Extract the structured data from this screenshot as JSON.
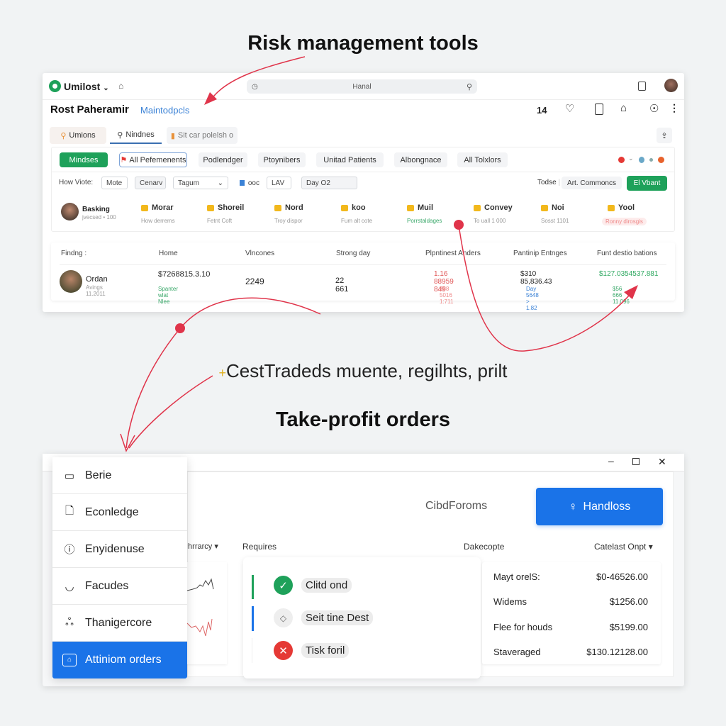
{
  "headings": {
    "top": "Risk management tools",
    "middle": "CestTradeds muente, regilhts, prilt",
    "bottom": "Take-profit orders"
  },
  "top_window": {
    "app_name": "Umilost",
    "search_placeholder": "Hanal",
    "page_title": "Rost Paheramir",
    "page_link": "Maintodpcls",
    "count": "14",
    "tabs": [
      "Umions",
      "Nindnes",
      "Sit car polelsh o"
    ],
    "filters": [
      "Mindses",
      "All Pefemenents",
      "Podlendger",
      "Ptoynibers",
      "Unitad Patients",
      "Albongnace",
      "All Tolxlors"
    ],
    "controls": {
      "label": "How Viote:",
      "mote": "Mote",
      "cenarv": "Cenarv",
      "select": "Tagum",
      "check_label": "ooc",
      "lav": "LAV",
      "day": "Day O2",
      "right_label": "Todse",
      "right_value": "Art. Commoncs",
      "action": "El Vbant"
    },
    "profile": {
      "name": "Basking",
      "sub": "jvecsed • 100"
    },
    "cards": [
      {
        "title": "Morar",
        "sub": "How derrems"
      },
      {
        "title": "Shoreil",
        "sub": "Fetnt Coft"
      },
      {
        "title": "Nord",
        "sub": "Troy dispor"
      },
      {
        "title": "koo",
        "sub": "Fum alt cote"
      },
      {
        "title": "Muil",
        "sub": "Porrstaldages"
      },
      {
        "title": "Convey",
        "sub": "To uall 1 000"
      },
      {
        "title": "Noi",
        "sub": "Sosst 1101"
      },
      {
        "title": "Yool",
        "sub": "Ronny dirosgis"
      }
    ],
    "table": {
      "headers": [
        "Findng :",
        "Home",
        "Vlncones",
        "Strong day",
        "Plpntinest Anders",
        "Pantinip Entnges",
        "Funt destio bations"
      ],
      "row": {
        "name": "Ordan",
        "sub": "Avings 11.2011",
        "home": "$7268815.3.10",
        "home_sub": "Spanter wlat Nlee",
        "vincones": "2249",
        "strong": "22 661",
        "plp": "1.16 88959 849",
        "plp_sub": "$88 5016 1:711",
        "pant": "$310 85,836.43",
        "pant_sub": "Day 5648 > 1.82",
        "funt": "$127.0354537.881",
        "funt_sub": "$56 666 11.096"
      }
    }
  },
  "bottom_window": {
    "menu": [
      "Berie",
      "Econledge",
      "Enyidenuse",
      "Facudes",
      "Thanigercore",
      "Attiniom orders"
    ],
    "menu_active": 5,
    "forms_label": "CibdForoms",
    "primary_button": "Handloss",
    "col_headers": [
      "Ihrrarcy",
      "Requires",
      "Dakecopte",
      "Catelast Onpt"
    ],
    "statuses": [
      {
        "label": "Clitd ond",
        "state": "success"
      },
      {
        "label": "Seit tine Dest",
        "state": "pending"
      },
      {
        "label": "Tisk foril",
        "state": "error"
      }
    ],
    "prices": [
      {
        "label": "Mayt orelS:",
        "value": "$0-46526.00"
      },
      {
        "label": "Widems",
        "value": "$1256.00"
      },
      {
        "label": "Flee for houds",
        "value": "$5199.00"
      },
      {
        "label": "Staveraged",
        "value": "$130.12128.00"
      }
    ]
  },
  "colors": {
    "accent_blue": "#1a73e8",
    "green": "#1ea15a",
    "red": "#e53935",
    "arrow": "#e0344a"
  }
}
